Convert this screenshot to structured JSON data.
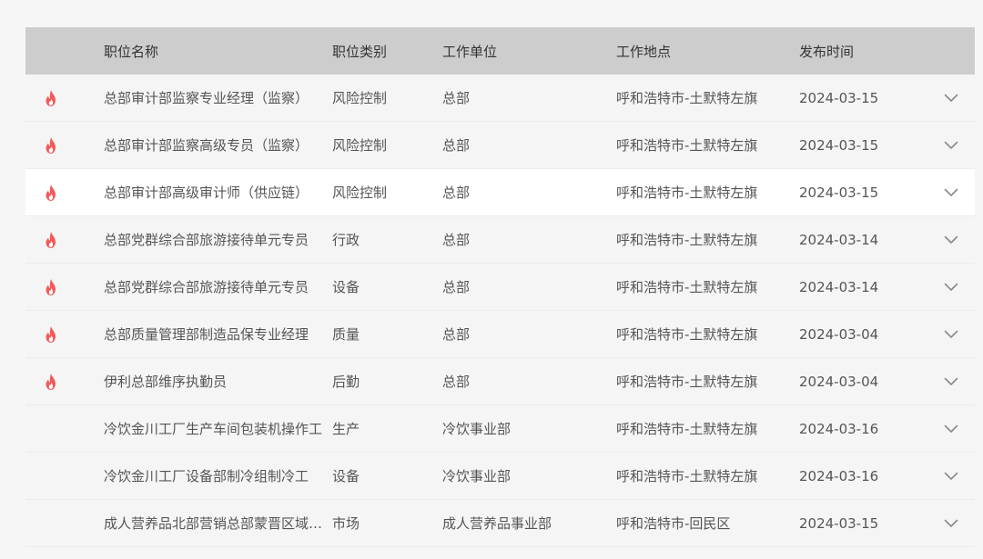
{
  "colors": {
    "fire": "#f25a5a",
    "header_bg": "#cdcdcd",
    "row_bg": "#f5f5f5",
    "highlight_row_bg": "#ffffff"
  },
  "header": {
    "title": "职位名称",
    "category": "职位类别",
    "unit": "工作单位",
    "location": "工作地点",
    "date": "发布时间"
  },
  "rows": [
    {
      "hot": true,
      "title": "总部审计部监察专业经理（监察）",
      "category": "风险控制",
      "unit": "总部",
      "location": "呼和浩特市-土默特左旗",
      "date": "2024-03-15",
      "location_truncated": true
    },
    {
      "hot": true,
      "title": "总部审计部监察高级专员（监察）",
      "category": "风险控制",
      "unit": "总部",
      "location": "呼和浩特市-土默特左旗",
      "date": "2024-03-15",
      "location_truncated": true
    },
    {
      "hot": true,
      "title": "总部审计部高级审计师（供应链）",
      "category": "风险控制",
      "unit": "总部",
      "location": "呼和浩特市-土默特左旗",
      "date": "2024-03-15"
    },
    {
      "hot": true,
      "title": "总部党群综合部旅游接待单元专员",
      "category": "行政",
      "unit": "总部",
      "location": "呼和浩特市-土默特左旗",
      "date": "2024-03-14"
    },
    {
      "hot": true,
      "title": "总部党群综合部旅游接待单元专员",
      "category": "设备",
      "unit": "总部",
      "location": "呼和浩特市-土默特左旗",
      "date": "2024-03-14"
    },
    {
      "hot": true,
      "title": "总部质量管理部制造品保专业经理",
      "category": "质量",
      "unit": "总部",
      "location": "呼和浩特市-土默特左旗",
      "date": "2024-03-04"
    },
    {
      "hot": true,
      "title": "伊利总部维序执勤员",
      "category": "后勤",
      "unit": "总部",
      "location": "呼和浩特市-土默特左旗",
      "date": "2024-03-04"
    },
    {
      "hot": false,
      "title": "冷饮金川工厂生产车间包装机操作工",
      "category": "生产",
      "unit": "冷饮事业部",
      "location": "呼和浩特市-土默特左旗",
      "date": "2024-03-16"
    },
    {
      "hot": false,
      "title": "冷饮金川工厂设备部制冷组制冷工",
      "category": "设备",
      "unit": "冷饮事业部",
      "location": "呼和浩特市-土默特左旗",
      "date": "2024-03-16"
    },
    {
      "hot": false,
      "title": "成人营养品北部营销总部蒙晋区域经理",
      "category": "市场",
      "unit": "成人营养品事业部",
      "location": "呼和浩特市-回民区",
      "date": "2024-03-15"
    }
  ],
  "icons": {
    "hot": "fire-icon",
    "expand": "chevron-down-icon"
  }
}
